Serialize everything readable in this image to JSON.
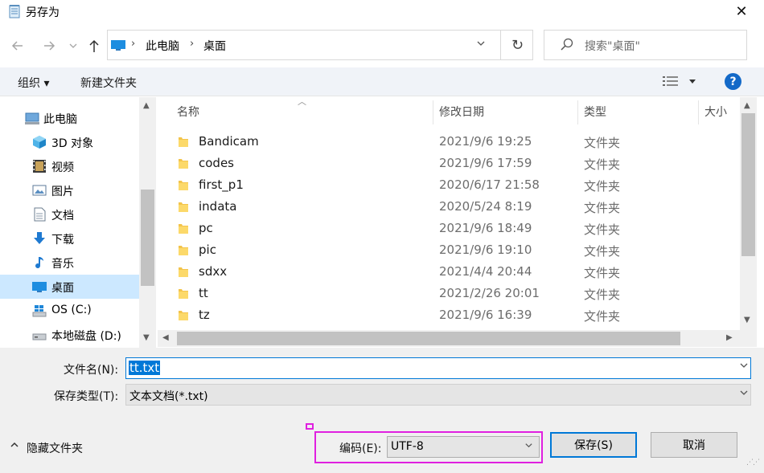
{
  "window": {
    "title": "另存为",
    "close_glyph": "✕"
  },
  "address": {
    "breadcrumbs": [
      "此电脑",
      "桌面"
    ],
    "refresh_glyph": "↻",
    "icon": "monitor-icon"
  },
  "search": {
    "placeholder": "搜索\"桌面\""
  },
  "toolbar": {
    "organize_label": "组织 ▾",
    "new_folder_label": "新建文件夹",
    "help_glyph": "?"
  },
  "nav_pane": {
    "items": [
      {
        "label": "此电脑",
        "icon": "computer-icon"
      },
      {
        "label": "3D 对象",
        "icon": "cube-3d-icon"
      },
      {
        "label": "视频",
        "icon": "film-icon"
      },
      {
        "label": "图片",
        "icon": "picture-icon"
      },
      {
        "label": "文档",
        "icon": "document-icon"
      },
      {
        "label": "下载",
        "icon": "download-icon"
      },
      {
        "label": "音乐",
        "icon": "music-icon"
      },
      {
        "label": "桌面",
        "icon": "desktop-icon",
        "selected": true
      },
      {
        "label": "OS (C:)",
        "icon": "windows-drive-icon"
      },
      {
        "label": "本地磁盘 (D:)",
        "icon": "drive-icon"
      }
    ]
  },
  "file_list": {
    "columns": [
      "名称",
      "修改日期",
      "类型",
      "大小"
    ],
    "rows": [
      {
        "name": "Bandicam",
        "modified": "2021/9/6 19:25",
        "type": "文件夹"
      },
      {
        "name": "codes",
        "modified": "2021/9/6 17:59",
        "type": "文件夹"
      },
      {
        "name": "first_p1",
        "modified": "2020/6/17 21:58",
        "type": "文件夹"
      },
      {
        "name": "indata",
        "modified": "2020/5/24 8:19",
        "type": "文件夹"
      },
      {
        "name": "pc",
        "modified": "2021/9/6 18:49",
        "type": "文件夹"
      },
      {
        "name": "pic",
        "modified": "2021/9/6 19:10",
        "type": "文件夹"
      },
      {
        "name": "sdxx",
        "modified": "2021/4/4 20:44",
        "type": "文件夹"
      },
      {
        "name": "tt",
        "modified": "2021/2/26 20:01",
        "type": "文件夹"
      },
      {
        "name": "tz",
        "modified": "2021/9/6 16:39",
        "type": "文件夹"
      }
    ]
  },
  "save_form": {
    "filename_label": "文件名(N):",
    "filename_value": "tt.txt",
    "filetype_label": "保存类型(T):",
    "filetype_value": "文本文档(*.txt)",
    "encoding_label": "编码(E):",
    "encoding_value": "UTF-8",
    "hide_folders_label": "隐藏文件夹",
    "save_label": "保存(S)",
    "cancel_label": "取消"
  },
  "colors": {
    "accent": "#0078d7",
    "highlight_frame": "#e020e0",
    "selection_bg": "#cce8ff",
    "folder": "#f3c44b"
  }
}
